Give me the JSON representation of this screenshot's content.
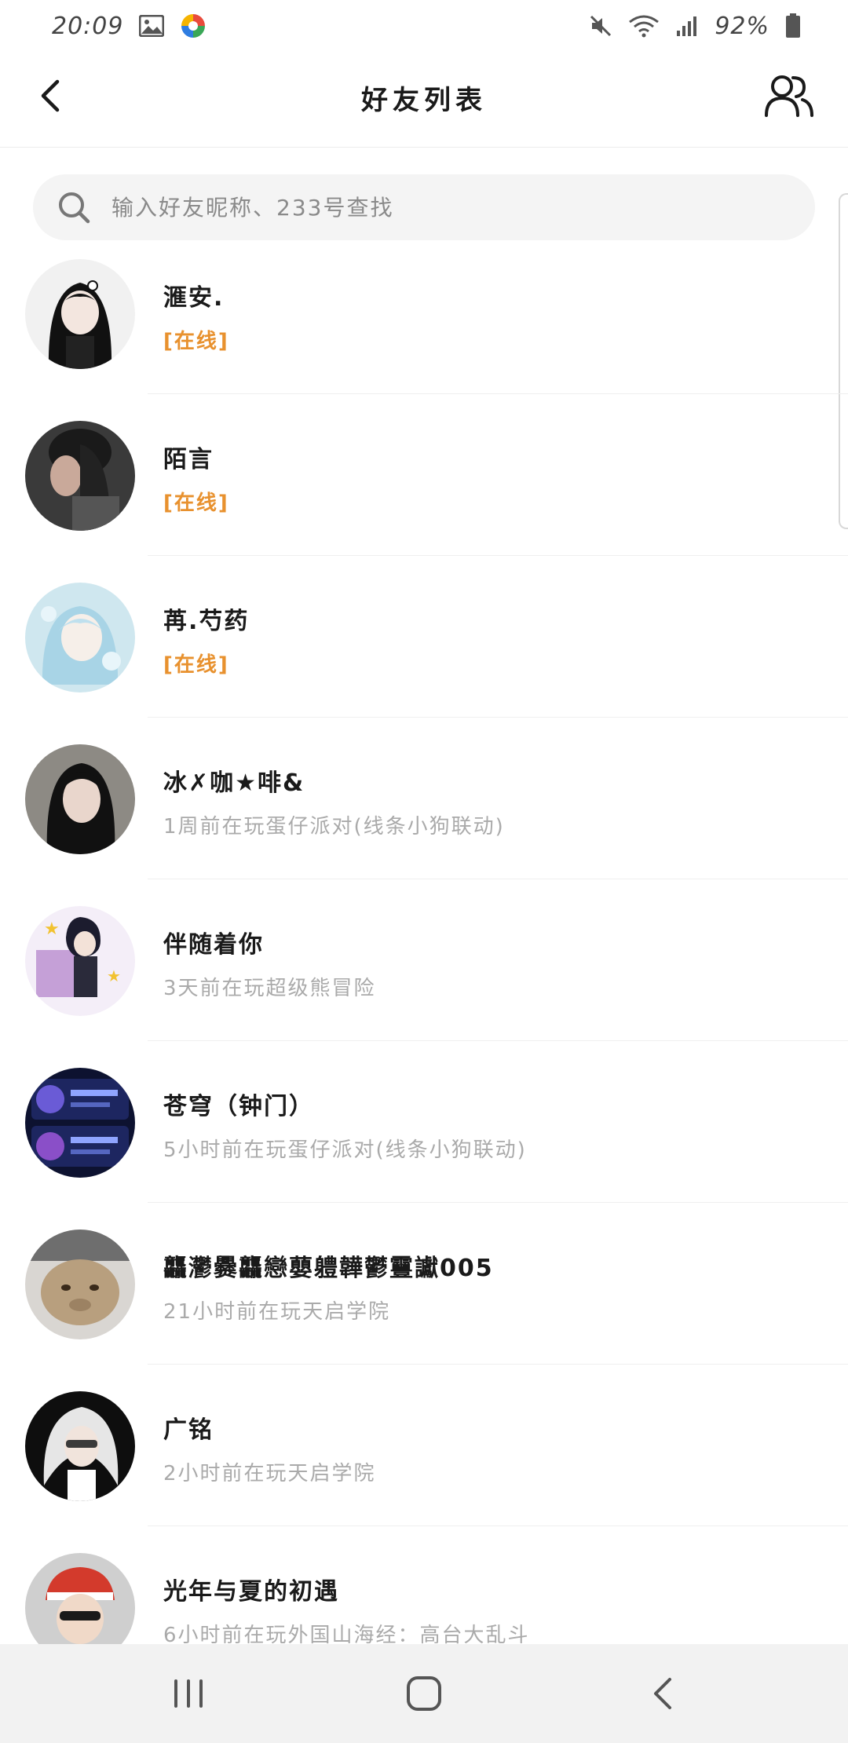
{
  "status_bar": {
    "time": "20:09",
    "battery_text": "92%",
    "left_icons": [
      "gallery-icon",
      "app-pinwheel-icon"
    ],
    "right_icons": [
      "mute-icon",
      "wifi-icon",
      "signal-icon",
      "battery-icon"
    ]
  },
  "header": {
    "title": "好友列表",
    "back_icon": "chevron-left-icon",
    "friends_icon": "users-icon"
  },
  "search": {
    "placeholder": "输入好友昵称、233号查找",
    "value": ""
  },
  "colors": {
    "online": "#e8912e",
    "offline_text": "#aaaaaa",
    "search_bg": "#f4f4f4",
    "nav_bg": "#f2f2f2"
  },
  "friends": [
    {
      "name": "滙安.",
      "status": "[在线]",
      "online": true
    },
    {
      "name": "陌言",
      "status": "[在线]",
      "online": true
    },
    {
      "name": "苒.芍药",
      "status": "[在线]",
      "online": true
    },
    {
      "name": "冰✗咖★啡&",
      "status": "1周前在玩蛋仔派对(线条小狗联动)",
      "online": false
    },
    {
      "name": "伴随着你",
      "status": "3天前在玩超级熊冒险",
      "online": false
    },
    {
      "name": "苍穹（钟门）",
      "status": "5小时前在玩蛋仔派对(线条小狗联动)",
      "online": false
    },
    {
      "name": "龘灪爨龘戀蘡軆韡鬱靊讞005",
      "status": "21小时前在玩天启学院",
      "online": false
    },
    {
      "name": "广铭",
      "status": "2小时前在玩天启学院",
      "online": false
    },
    {
      "name": "光年与夏的初遇",
      "status": "6小时前在玩外国山海经：高台大乱斗",
      "online": false
    }
  ],
  "nav": {
    "recents_icon": "recents-icon",
    "home_icon": "home-icon",
    "back_icon": "back-icon"
  }
}
